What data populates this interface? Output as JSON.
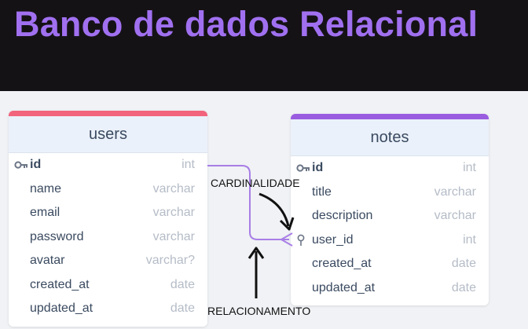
{
  "header": {
    "title": "Banco de dados Relacional"
  },
  "tables": {
    "users": {
      "name": "users",
      "fields": [
        {
          "name": "id",
          "type": "int"
        },
        {
          "name": "name",
          "type": "varchar"
        },
        {
          "name": "email",
          "type": "varchar"
        },
        {
          "name": "password",
          "type": "varchar"
        },
        {
          "name": "avatar",
          "type": "varchar?"
        },
        {
          "name": "created_at",
          "type": "date"
        },
        {
          "name": "updated_at",
          "type": "date"
        }
      ]
    },
    "notes": {
      "name": "notes",
      "fields": [
        {
          "name": "id",
          "type": "int"
        },
        {
          "name": "title",
          "type": "varchar"
        },
        {
          "name": "description",
          "type": "varchar"
        },
        {
          "name": "user_id",
          "type": "int"
        },
        {
          "name": "created_at",
          "type": "date"
        },
        {
          "name": "updated_at",
          "type": "date"
        }
      ]
    }
  },
  "annotations": {
    "cardinality": "CARDINALIDADE",
    "relationship": "RELACIONAMENTO"
  },
  "colors": {
    "title": "#a070f0",
    "header_bg": "#151216",
    "users_accent": "#f2647c",
    "notes_accent": "#9a5de0",
    "relation_line": "#a87ee6"
  }
}
